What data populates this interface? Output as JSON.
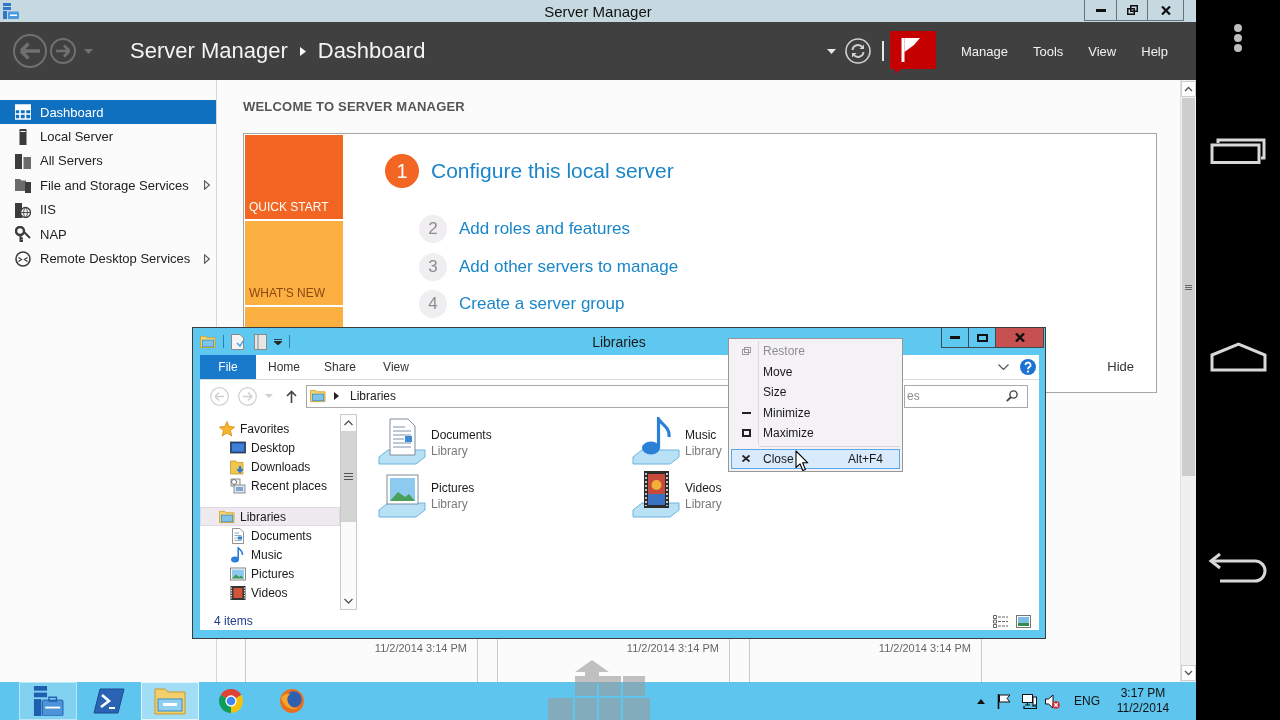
{
  "server_manager": {
    "title": "Server Manager",
    "breadcrumb": [
      "Server Manager",
      "Dashboard"
    ],
    "menu": [
      "Manage",
      "Tools",
      "View",
      "Help"
    ],
    "sidebar": {
      "items": [
        {
          "label": "Dashboard",
          "selected": true,
          "expandable": false
        },
        {
          "label": "Local Server",
          "selected": false,
          "expandable": false
        },
        {
          "label": "All Servers",
          "selected": false,
          "expandable": false
        },
        {
          "label": "File and Storage Services",
          "selected": false,
          "expandable": true
        },
        {
          "label": "IIS",
          "selected": false,
          "expandable": false
        },
        {
          "label": "NAP",
          "selected": false,
          "expandable": false
        },
        {
          "label": "Remote Desktop Services",
          "selected": false,
          "expandable": true
        }
      ]
    },
    "welcome": {
      "heading": "WELCOME TO SERVER MANAGER",
      "tiles": [
        {
          "label": "QUICK START",
          "selected": true
        },
        {
          "label": "WHAT'S NEW",
          "selected": false
        },
        {
          "selected": false
        }
      ],
      "steps": [
        {
          "number": "1",
          "label": "Configure this local server",
          "kind": "primary"
        },
        {
          "number": "2",
          "label": "Add roles and features",
          "kind": "secondary"
        },
        {
          "number": "3",
          "label": "Add other servers to manage",
          "kind": "secondary"
        },
        {
          "number": "4",
          "label": "Create a server group",
          "kind": "secondary"
        }
      ],
      "hide": "Hide"
    },
    "role_tiles": [
      {
        "timestamp": "11/2/2014 3:14 PM"
      },
      {
        "timestamp": "11/2/2014 3:14 PM"
      },
      {
        "timestamp": "11/2/2014 3:14 PM"
      }
    ]
  },
  "libraries_window": {
    "title": "Libraries",
    "ribbon_tabs": [
      {
        "label": "File",
        "kind": "menu"
      },
      {
        "label": "Home",
        "kind": "tab"
      },
      {
        "label": "Share",
        "kind": "tab"
      },
      {
        "label": "View",
        "kind": "tab"
      }
    ],
    "address": "Libraries",
    "search": {
      "placeholder": "es"
    },
    "navigation": [
      {
        "label": "Favorites",
        "selected": false,
        "children": [
          {
            "label": "Desktop",
            "selected": false
          },
          {
            "label": "Downloads",
            "selected": false
          },
          {
            "label": "Recent places",
            "selected": false
          }
        ]
      },
      {
        "label": "Libraries",
        "selected": true,
        "children": [
          {
            "label": "Documents",
            "selected": false
          },
          {
            "label": "Music",
            "selected": false
          },
          {
            "label": "Pictures",
            "selected": false
          },
          {
            "label": "Videos",
            "selected": false
          }
        ]
      }
    ],
    "items": [
      {
        "name": "Documents",
        "type": "Library"
      },
      {
        "name": "Music",
        "type": "Library"
      },
      {
        "name": "Pictures",
        "type": "Library"
      },
      {
        "name": "Videos",
        "type": "Library"
      }
    ],
    "status": "4 items"
  },
  "system_menu": {
    "groups": [
      {
        "items": [
          {
            "label": "Restore",
            "disabled": true,
            "selected": false
          },
          {
            "label": "Move",
            "disabled": false,
            "selected": false
          },
          {
            "label": "Size",
            "disabled": false,
            "selected": false
          },
          {
            "label": "Minimize",
            "disabled": false,
            "selected": false
          },
          {
            "label": "Maximize",
            "disabled": false,
            "selected": false
          }
        ]
      },
      {
        "items": [
          {
            "label": "Close",
            "shortcut": "Alt+F4",
            "disabled": false,
            "selected": true
          }
        ]
      }
    ]
  },
  "taskbar": {
    "apps": [
      {
        "running": true,
        "active": false
      },
      {
        "running": false,
        "active": false
      },
      {
        "running": true,
        "active": true
      },
      {
        "running": false,
        "active": false
      },
      {
        "running": false,
        "active": false
      }
    ],
    "language": "ENG",
    "time": "3:17 PM",
    "date": "11/2/2014"
  }
}
